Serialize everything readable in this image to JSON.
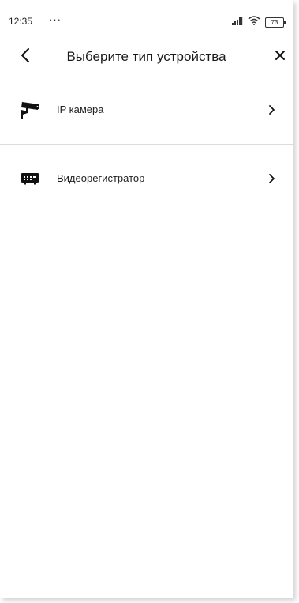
{
  "status_bar": {
    "time": "12:35",
    "dots": "···",
    "battery": "73",
    "icons": [
      "signal-icon",
      "wifi-icon",
      "battery-icon"
    ]
  },
  "header": {
    "title": "Выберите тип устройства",
    "back_icon": "back-arrow-icon",
    "close_icon": "close-icon"
  },
  "devices": [
    {
      "label": "IP камера",
      "icon": "security-camera-icon"
    },
    {
      "label": "Видеорегистратор",
      "icon": "dvr-recorder-icon"
    }
  ],
  "colors": {
    "background": "#ffffff",
    "text": "#1a1a1a",
    "divider": "#dcdcdc",
    "icon": "#111111"
  }
}
